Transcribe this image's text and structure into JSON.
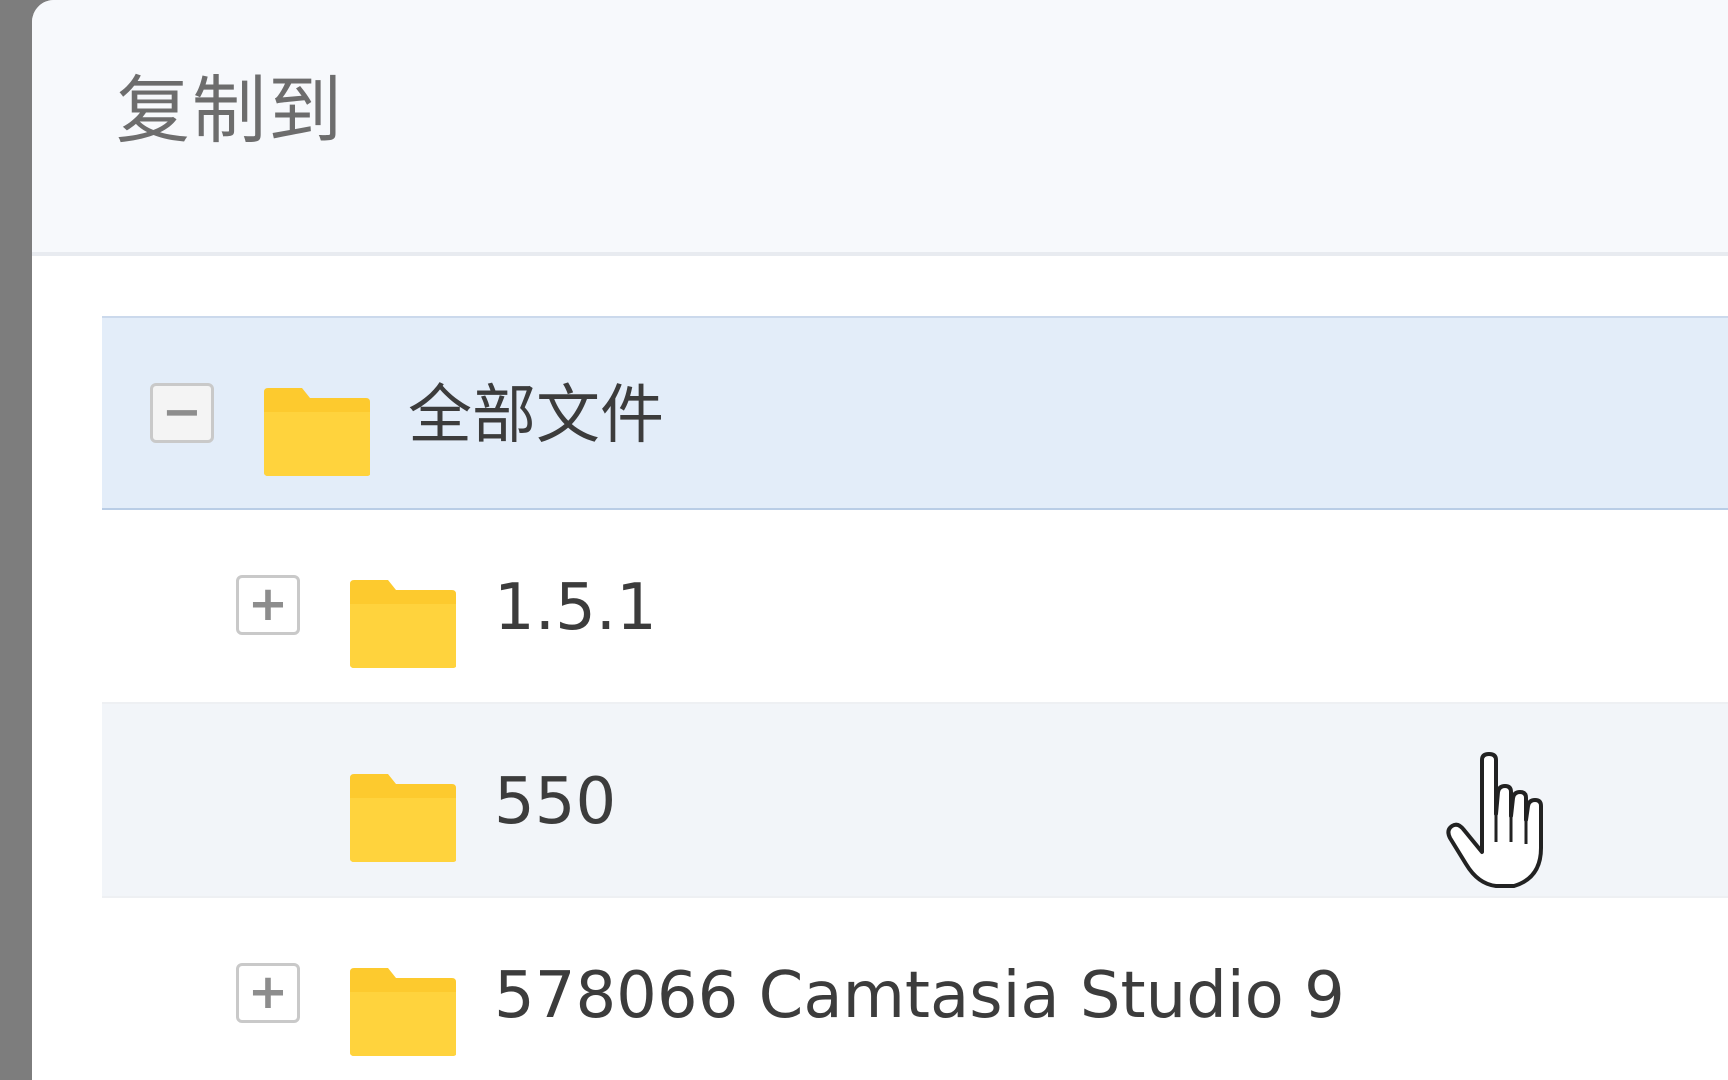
{
  "dialog": {
    "title": "复制到"
  },
  "tree": {
    "items": [
      {
        "label": "全部文件",
        "toggle": "−",
        "state": "expanded",
        "selected": true
      },
      {
        "label": "1.5.1",
        "toggle": "+",
        "state": "collapsed",
        "selected": false
      },
      {
        "label": "550",
        "toggle": "",
        "state": "leaf",
        "selected": false
      },
      {
        "label": "578066 Camtasia Studio 9",
        "toggle": "+",
        "state": "collapsed",
        "selected": false
      }
    ]
  },
  "colors": {
    "folder": "#fdca2e",
    "selection": "#e3edf9",
    "hover": "#f2f5f9"
  },
  "icons": {
    "folder": "folder-icon",
    "expand": "plus-box-icon",
    "collapse": "minus-box-icon",
    "cursor": "hand-pointer-icon"
  }
}
